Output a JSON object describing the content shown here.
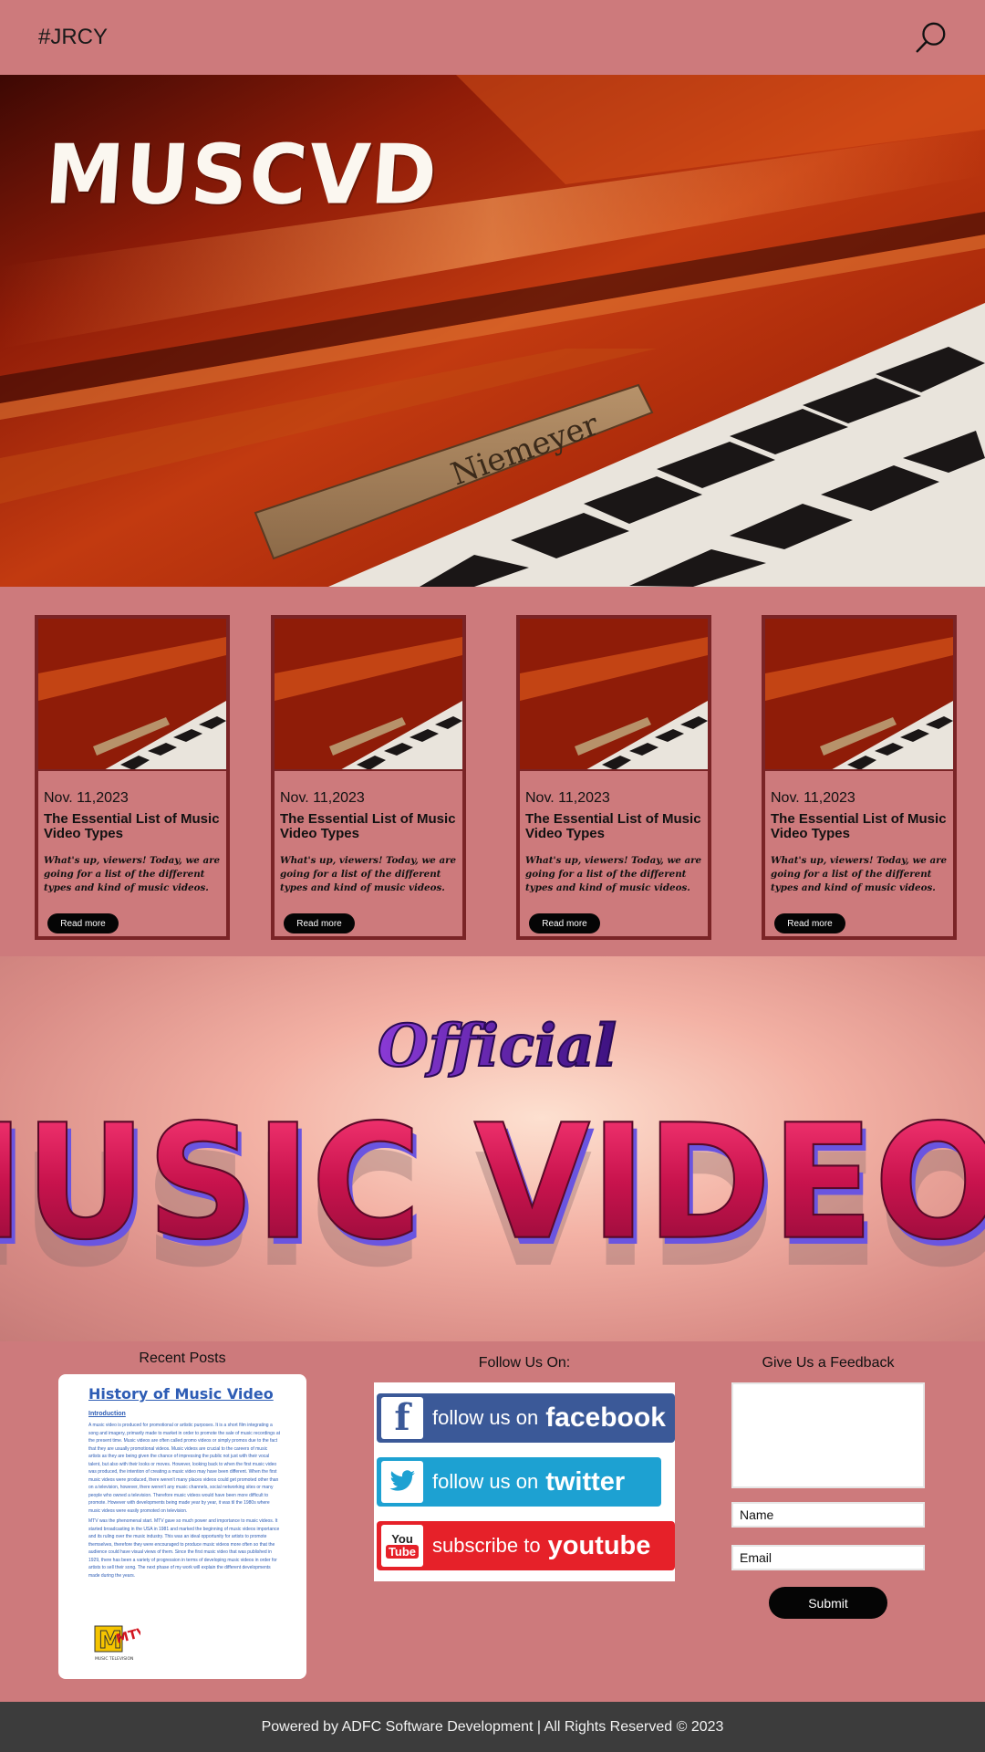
{
  "header": {
    "brand": "#JRCY",
    "search_icon": "search-icon"
  },
  "hero": {
    "logo_text": "MUSCVD",
    "plate_text": "Niemeyer"
  },
  "cards": [
    {
      "date": "Nov. 11,2023",
      "title": "The Essential List of Music Video Types",
      "excerpt": "What's up, viewers! Today, we are going for a list of the different types and kind of  music videos.",
      "button": "Read more"
    },
    {
      "date": "Nov. 11,2023",
      "title": "The Essential List of Music Video Types",
      "excerpt": "What's up, viewers! Today, we are going for a list of the different types and kind of  music videos.",
      "button": "Read more"
    },
    {
      "date": "Nov. 11,2023",
      "title": "The Essential List of Music Video Types",
      "excerpt": "What's up, viewers! Today, we are going for a list of the different types and kind of  music videos.",
      "button": "Read more"
    },
    {
      "date": "Nov. 11,2023",
      "title": "The Essential List of Music Video Types",
      "excerpt": "What's up, viewers! Today, we are going for a list of the different types and kind of  music videos.",
      "button": "Read more"
    }
  ],
  "banner": {
    "script_text": "Official",
    "main_text": "MUSIC VIDEOS"
  },
  "recent_posts": {
    "title": "Recent Posts",
    "doc_title": "History of Music Video",
    "doc_subtitle": "Introduction",
    "doc_para1": "A music video is produced for promotional or artistic purposes. It is a short film integrating a song and imagery, primarily made to market in order to promote the sale of music recordings at the present time. Music videos are often called promo videos or simply promos due to the fact that they are usually promotional videos. Music videos are crucial to the careers of music artists as they are being given the chance of impressing the public not just with their vocal talent, but also with their looks or moves. However, looking back to when the first music video was produced, the intention of creating a music video may have been different. When the first music videos were produced, there weren't many places videos could get promoted other than on a television, however, there weren't any music channels, social networking sites or many people who owned a television. Therefore music videos would have been more difficult to promote. However with developments being made year by year, it was til the 1980s where music videos were easily promoted on television.",
    "doc_para2": "MTV was the phenomenal start. MTV gave so much power and importance to music videos. It started broadcasting in the USA in 1981 and marked the beginning of music videos importance and its ruling over the music industry. This was an ideal opportunity for artists to promote themselves, therefore they were encouraged to produce music videos more often so that the audience could have visual views of them. Since the first music video that was published in 1929, there has been a variety of progression in terms of developing music videos in order for artists to sell their song. The next phase of my work will explain the different developments made during the years.",
    "logo_text": "MTV",
    "logo_sub": "MUSIC TELEVISION"
  },
  "follow": {
    "title": "Follow Us On:",
    "facebook": {
      "prefix": "follow us on",
      "name": "facebook",
      "color": "#3b5998"
    },
    "twitter": {
      "prefix": "follow us on",
      "name": "twitter",
      "color": "#1da1d2"
    },
    "youtube": {
      "prefix": "subscribe to",
      "name": "youtube",
      "color": "#e62129"
    }
  },
  "feedback": {
    "title": "Give Us a Feedback",
    "name_placeholder": "Name",
    "email_placeholder": "Email",
    "submit": "Submit"
  },
  "footer": {
    "text": "Powered by ADFC Software Development | All Rights Reserved © 2023"
  }
}
